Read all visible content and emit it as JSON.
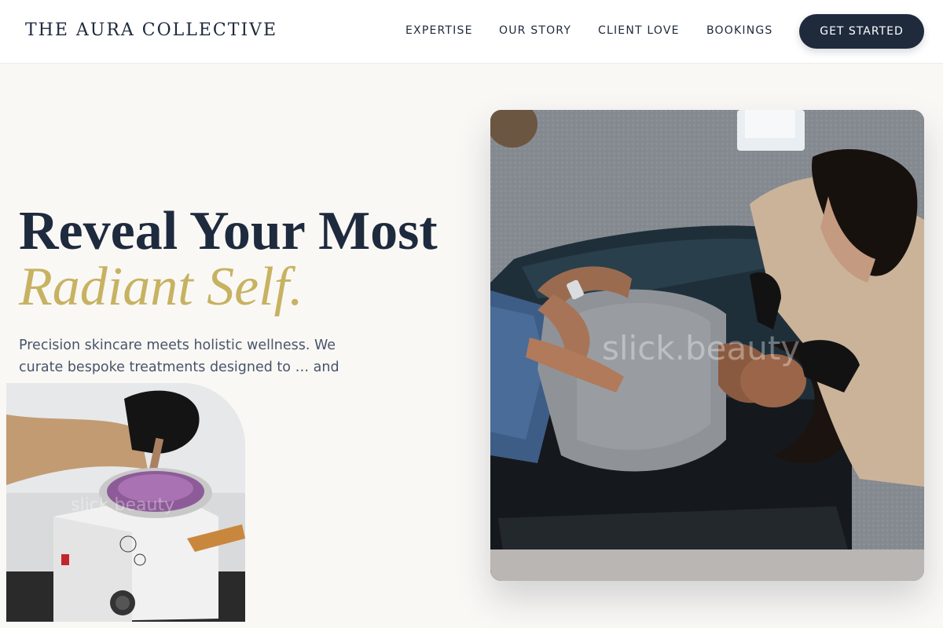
{
  "brand": {
    "name": "THE AURA COLLECTIVE"
  },
  "nav": {
    "links": [
      "EXPERTISE",
      "OUR STORY",
      "CLIENT LOVE",
      "BOOKINGS"
    ],
    "cta_label": "GET STARTED"
  },
  "hero": {
    "headline_line1": "Reveal Your Most",
    "headline_line2": "Radiant Self.",
    "description": "Precision skincare meets holistic wellness. We curate bespoke treatments designed to … and elevate your",
    "main_image_watermark": "slick.beauty",
    "secondary_image_watermark": "slick.beauty"
  },
  "colors": {
    "navy": "#1f2a3d",
    "gold": "#c7b262",
    "background": "#faf8f5",
    "body_text": "#475569"
  }
}
